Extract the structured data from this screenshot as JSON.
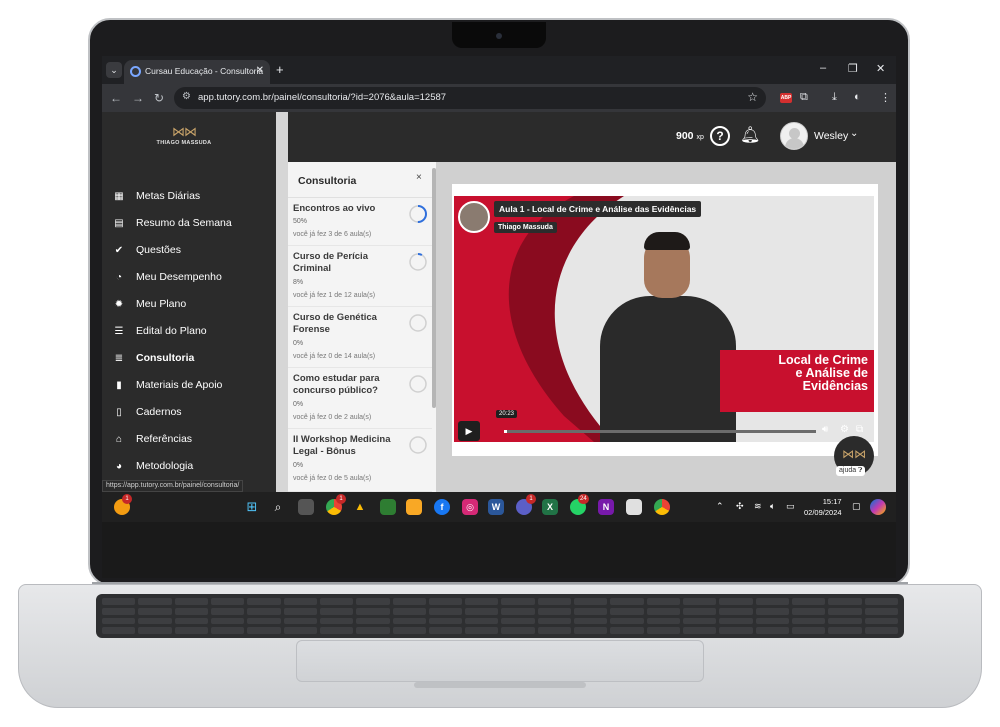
{
  "browser": {
    "tab_title": "Cursau Educação - Consultoria",
    "tab_close": "✕",
    "new_tab": "+",
    "url": "app.tutory.com.br/painel/consultoria/?id=2076&aula=12587",
    "status_url": "https://app.tutory.com.br/painel/consultoria/",
    "window_controls": [
      "–",
      "❐",
      "✕"
    ]
  },
  "sidebar": {
    "logo_name": "THIAGO MASSUDA",
    "items": [
      {
        "label": "Metas Diárias",
        "icon": "calendar-icon"
      },
      {
        "label": "Resumo da Semana",
        "icon": "calendar-week-icon"
      },
      {
        "label": "Questões",
        "icon": "check-icon"
      },
      {
        "label": "Meu Desempenho",
        "icon": "gauge-icon"
      },
      {
        "label": "Meu Plano",
        "icon": "gear-icon"
      },
      {
        "label": "Edital do Plano",
        "icon": "list-icon"
      },
      {
        "label": "Consultoria",
        "icon": "align-icon",
        "active": true
      },
      {
        "label": "Materiais de Apoio",
        "icon": "book-icon"
      },
      {
        "label": "Cadernos",
        "icon": "file-icon"
      },
      {
        "label": "Referências",
        "icon": "bank-icon"
      },
      {
        "label": "Metodologia",
        "icon": "brain-icon"
      }
    ]
  },
  "header": {
    "xp_value": "900",
    "xp_unit": "xp",
    "help": "?",
    "user_name": "Wesley"
  },
  "panel": {
    "title": "Consultoria",
    "close": "×",
    "courses": [
      {
        "title": "Encontros ao vivo",
        "pct": "50%",
        "progress": 0.5,
        "sub": "você já fez 3 de 6 aula(s)"
      },
      {
        "title": "Curso de Perícia Criminal",
        "pct": "8%",
        "progress": 0.08,
        "sub": "você já fez 1 de 12 aula(s)"
      },
      {
        "title": "Curso de Genética Forense",
        "pct": "0%",
        "progress": 0,
        "sub": "você já fez 0 de 14 aula(s)"
      },
      {
        "title": "Como estudar para concurso público?",
        "pct": "0%",
        "progress": 0,
        "sub": "você já fez 0 de 2 aula(s)"
      },
      {
        "title": "II Workshop Medicina Legal - Bônus",
        "pct": "0%",
        "progress": 0,
        "sub": "você já fez 0 de 5 aula(s)"
      }
    ]
  },
  "video": {
    "title": "Aula 1 - Local de Crime e Análise das Evidências",
    "author": "Thiago Massuda",
    "banner": "Local de Crime e Análise de Evidências",
    "time_tooltip": "20:23",
    "progress": 0.01
  },
  "help_widget": {
    "label": "ajuda"
  },
  "taskbar": {
    "clock_time": "15:17",
    "clock_date": "02/09/2024",
    "badges": {
      "chrome": "1",
      "teams": "1",
      "whatsapp": "24",
      "weather": "1"
    }
  }
}
